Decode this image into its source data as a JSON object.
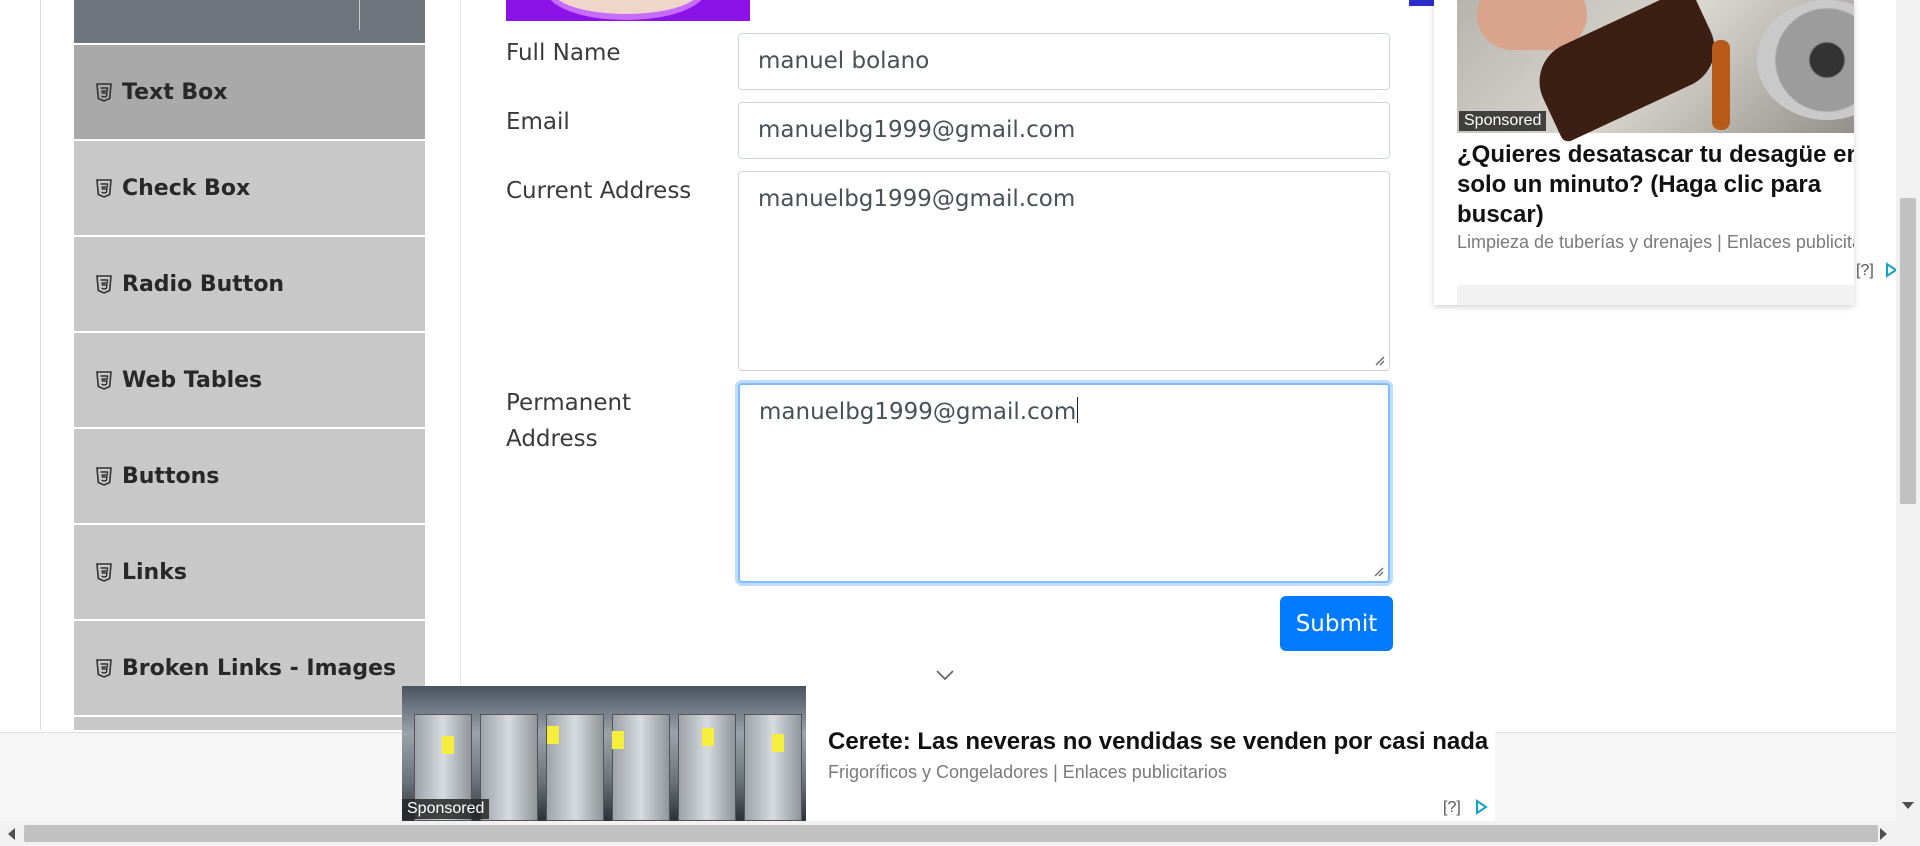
{
  "sidebar": {
    "items": [
      {
        "label": "Text Box",
        "icon": "html5-icon",
        "active": true
      },
      {
        "label": "Check Box",
        "icon": "html5-icon"
      },
      {
        "label": "Radio Button",
        "icon": "html5-icon"
      },
      {
        "label": "Web Tables",
        "icon": "html5-icon"
      },
      {
        "label": "Buttons",
        "icon": "html5-icon"
      },
      {
        "label": "Links",
        "icon": "html5-icon"
      },
      {
        "label": "Broken Links - Images",
        "icon": "html5-icon"
      }
    ]
  },
  "form": {
    "full_name": {
      "label": "Full Name",
      "value": "manuel bolano"
    },
    "email": {
      "label": "Email",
      "value": "manuelbg1999@gmail.com"
    },
    "current_address": {
      "label": "Current Address",
      "value": "manuelbg1999@gmail.com"
    },
    "permanent_address": {
      "label_line1": "Permanent",
      "label_line2": "Address",
      "value": "manuelbg1999@gmail.com"
    },
    "submit_label": "Submit"
  },
  "ad_right": {
    "sponsored": "Sponsored",
    "title": "¿Quieres desatascar tu desagüe en solo un minuto? (Haga clic para buscar)",
    "source": "Limpieza de tuberías y drenajes | Enlaces publicitarios",
    "help": "[?]"
  },
  "ad_bottom": {
    "sponsored": "Sponsored",
    "title": "Cerete: Las neveras no vendidas se venden por casi nada",
    "source": "Frigoríficos y Congeladores | Enlaces publicitarios",
    "help": "[?]"
  },
  "colors": {
    "accent": "#007bff",
    "sidebar_active": "#a9a9a9",
    "sidebar_item": "#c8c8c8",
    "focus_border": "#80bdff"
  }
}
